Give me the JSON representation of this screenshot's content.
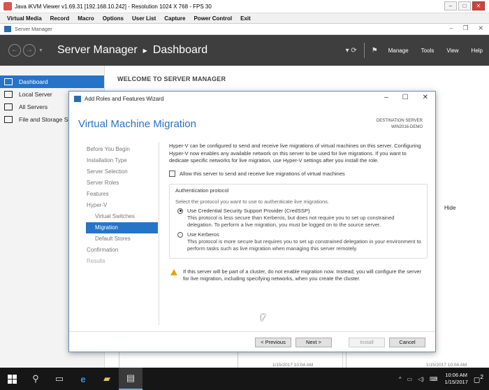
{
  "kvm": {
    "title": "Java iKVM Viewer v1.69.31 [192.168.10.242]  - Resolution 1024 X 768 - FPS 30",
    "menu": [
      "Virtual Media",
      "Record",
      "Macro",
      "Options",
      "User List",
      "Capture",
      "Power Control",
      "Exit"
    ]
  },
  "server_manager": {
    "window_title": "Server Manager",
    "breadcrumb_app": "Server Manager",
    "breadcrumb_page": "Dashboard",
    "header_menu": [
      "Manage",
      "Tools",
      "View",
      "Help"
    ],
    "sidebar": [
      {
        "label": "Dashboard",
        "active": true
      },
      {
        "label": "Local Server",
        "active": false
      },
      {
        "label": "All Servers",
        "active": false
      },
      {
        "label": "File and Storage Services",
        "active": false
      }
    ],
    "welcome": "WELCOME TO SERVER MANAGER",
    "hide": "Hide",
    "bg_timestamp_1": "1/15/2017 10:04 AM",
    "bg_timestamp_2": "1/15/2017 10:04 AM"
  },
  "wizard": {
    "window_title": "Add Roles and Features Wizard",
    "heading": "Virtual Machine Migration",
    "destination_label": "DESTINATION SERVER",
    "destination_value": "WIN2016-DEMO",
    "nav": [
      {
        "label": "Before You Begin",
        "indent": false,
        "state": "normal"
      },
      {
        "label": "Installation Type",
        "indent": false,
        "state": "normal"
      },
      {
        "label": "Server Selection",
        "indent": false,
        "state": "normal"
      },
      {
        "label": "Server Roles",
        "indent": false,
        "state": "normal"
      },
      {
        "label": "Features",
        "indent": false,
        "state": "normal"
      },
      {
        "label": "Hyper-V",
        "indent": false,
        "state": "normal"
      },
      {
        "label": "Virtual Switches",
        "indent": true,
        "state": "normal"
      },
      {
        "label": "Migration",
        "indent": true,
        "state": "active"
      },
      {
        "label": "Default Stores",
        "indent": true,
        "state": "normal"
      },
      {
        "label": "Confirmation",
        "indent": false,
        "state": "normal"
      },
      {
        "label": "Results",
        "indent": false,
        "state": "disabled"
      }
    ],
    "intro": "Hyper-V can be configured to send and receive live migrations of virtual machines on this server. Configuring Hyper-V now enables any available network on this server to be used for live migrations. If you want to dedicate specific networks for live migration, use Hyper-V settings after you install the role.",
    "checkbox_label": "Allow this server to send and receive live migrations of virtual machines",
    "checkbox_checked": false,
    "auth_legend": "Authentication protocol",
    "auth_prompt": "Select the protocol you want to use to authenticate live migrations.",
    "options": [
      {
        "title": "Use Credential Security Support Provider (CredSSP)",
        "desc": "This protocol is less secure than Kerberos, but does not require you to set up constrained delegation. To perform a live migration, you must be logged on to the source server.",
        "selected": true
      },
      {
        "title": "Use Kerberos",
        "desc": "This protocol is more secure but requires you to set up constrained delegation in your environment to perform tasks such as live migration when managing this server remotely.",
        "selected": false
      }
    ],
    "warning": "If this server will be part of a cluster, do not enable migration now. Instead, you will configure the server for live migration, including specifying networks, when you create the cluster.",
    "buttons": {
      "previous": "< Previous",
      "next": "Next >",
      "install": "Install",
      "cancel": "Cancel"
    }
  },
  "taskbar": {
    "time": "10:06 AM",
    "date": "1/15/2017",
    "notification_count": "2"
  },
  "colors": {
    "accent": "#2674c7",
    "header_bg": "#3e3e3e",
    "taskbar_bg": "#161616",
    "warning": "#e8a400"
  }
}
